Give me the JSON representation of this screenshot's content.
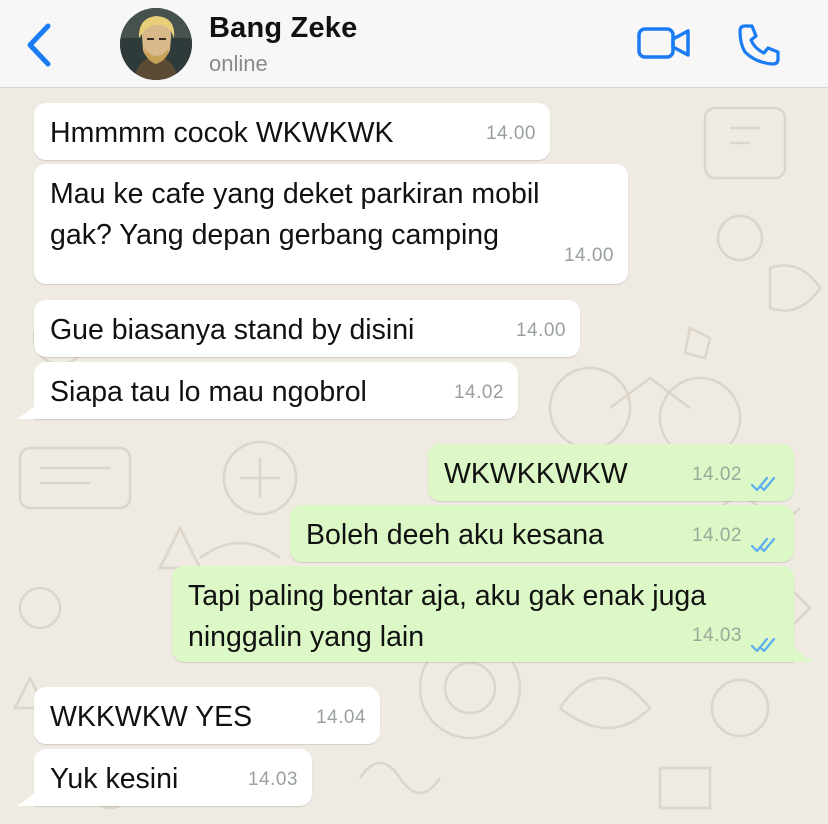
{
  "header": {
    "contact_name": "Bang Zeke",
    "contact_status": "online"
  },
  "colors": {
    "accent": "#1a7cf5",
    "incoming_bubble": "#ffffff",
    "outgoing_bubble": "#dcf8c6",
    "read_ticks": "#5aaef0",
    "wallpaper": "#efeae2"
  },
  "icons": {
    "back": "chevron-left-icon",
    "video": "video-camera-icon",
    "call": "phone-icon",
    "read": "double-check-icon"
  },
  "messages": [
    {
      "direction": "incoming",
      "text": "Hmmmm cocok WKWKWK",
      "time": "14.00"
    },
    {
      "direction": "incoming",
      "lines": [
        "Mau ke cafe yang deket parkiran mobil",
        "gak? Yang depan gerbang camping"
      ],
      "time": "14.00"
    },
    {
      "direction": "incoming",
      "text": "Gue biasanya stand by disini",
      "time": "14.00"
    },
    {
      "direction": "incoming",
      "text": "Siapa tau lo mau ngobrol",
      "time": "14.02"
    },
    {
      "direction": "outgoing",
      "text": "WKWKKWKW",
      "time": "14.02",
      "read": true
    },
    {
      "direction": "outgoing",
      "text": "Boleh deeh aku kesana",
      "time": "14.02",
      "read": true
    },
    {
      "direction": "outgoing",
      "lines": [
        "Tapi paling bentar aja, aku gak enak juga",
        "ninggalin yang lain"
      ],
      "time": "14.03",
      "read": true
    },
    {
      "direction": "incoming",
      "text": "WKKWKW YES",
      "time": "14.04"
    },
    {
      "direction": "incoming",
      "text": "Yuk kesini",
      "time": "14.03"
    }
  ]
}
